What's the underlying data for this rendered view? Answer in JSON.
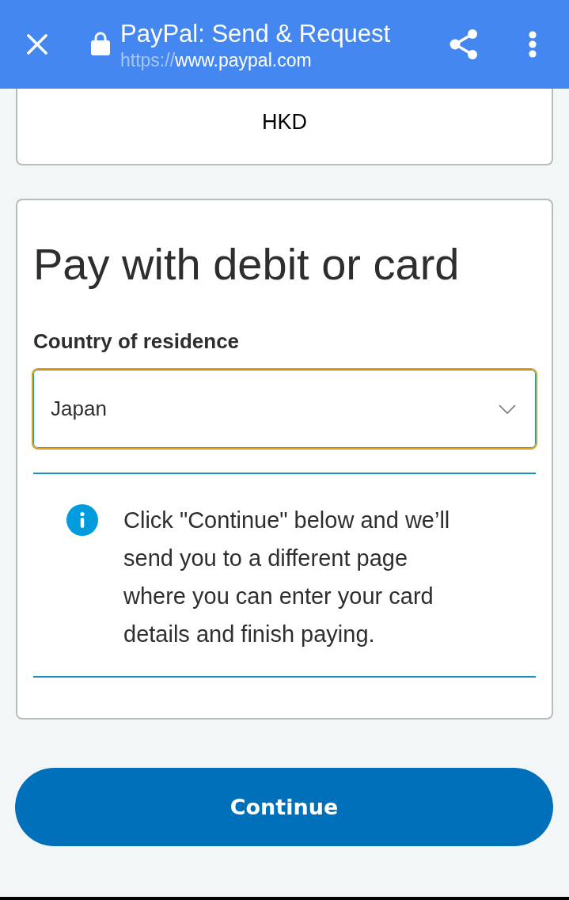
{
  "browser_bar": {
    "title": "PayPal: Send & Request",
    "url_scheme": "https://",
    "url_host": "www.paypal.com"
  },
  "currency_card": {
    "value": "HKD"
  },
  "payment_card": {
    "title": "Pay with debit or card",
    "country_label": "Country of residence",
    "country_select": {
      "value": "Japan",
      "focused": true
    },
    "notice": "Click \"Continue\" below and we’ll send you to a different page where you can enter your card details and finish paying."
  },
  "continue_button": {
    "label": "Continue"
  }
}
